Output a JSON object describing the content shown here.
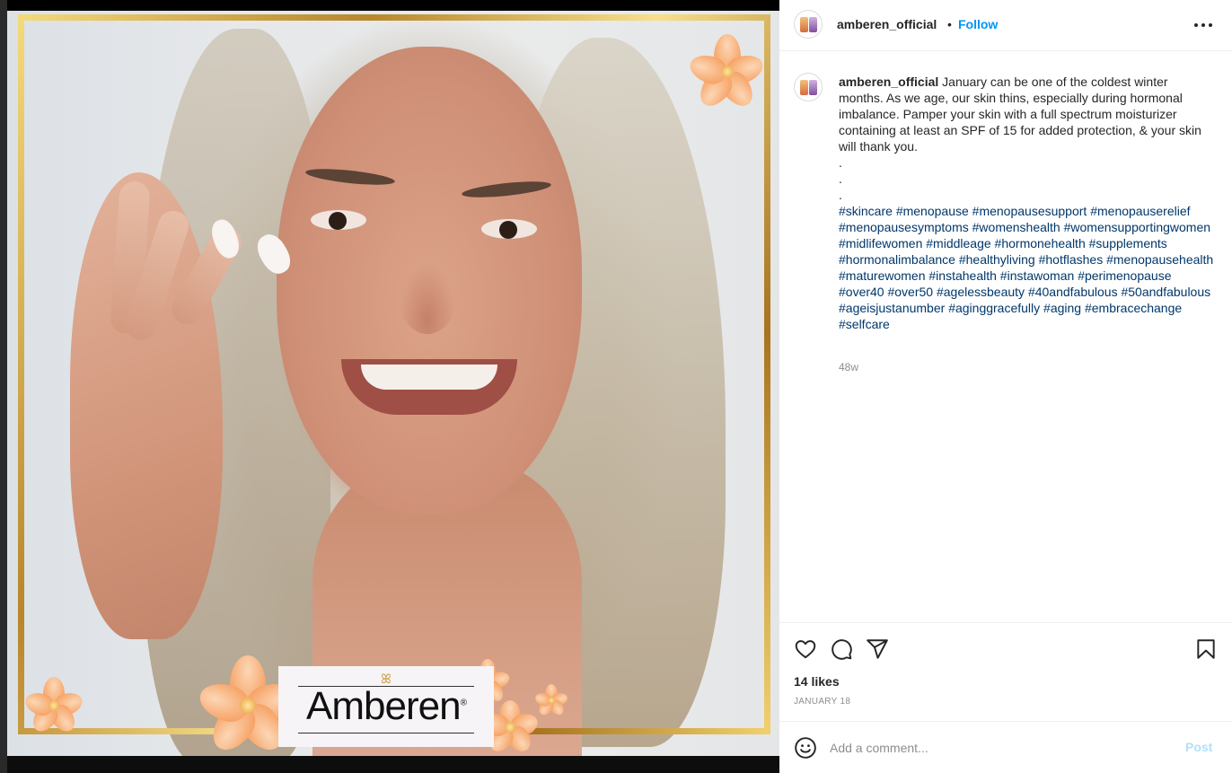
{
  "post": {
    "image_alt": "Smiling woman with long grey-blonde hair applying cream to her face, framed by a gold border with orange flowers",
    "brand_logo_text": "Amberen",
    "brand_logo_mark": "®"
  },
  "header": {
    "username": "amberen_official",
    "separator": "•",
    "follow_label": "Follow",
    "more_icon": "more-horizontal-icon"
  },
  "caption": {
    "username": "amberen_official",
    "text": "January can be one of the coldest winter months. As we age, our skin thins, especially during hormonal imbalance. Pamper your skin with a full spectrum moisturizer containing at least an SPF of 15 for added protection, & your skin will thank you.",
    "dots": [
      ".",
      ".",
      "."
    ],
    "hashtags": [
      "#skincare",
      "#menopause",
      "#menopausesupport",
      "#menopauserelief",
      "#menopausesymptoms",
      "#womenshealth",
      "#womensupportingwomen",
      "#midlifewomen",
      "#middleage",
      "#hormonehealth",
      "#supplements",
      "#hormonalimbalance",
      "#healthyliving",
      "#hotflashes",
      "#menopausehealth",
      "#maturewomen",
      "#instahealth",
      "#instawoman",
      "#perimenopause",
      "#over40",
      "#over50",
      "#agelessbeauty",
      "#40andfabulous",
      "#50andfabulous",
      "#ageisjustanumber",
      "#aginggracefully",
      "#aging",
      "#embracechange",
      "#selfcare"
    ],
    "time_ago": "48w"
  },
  "actions": {
    "like_icon": "heart-icon",
    "comment_icon": "comment-bubble-icon",
    "share_icon": "paper-plane-icon",
    "save_icon": "bookmark-icon",
    "likes_text": "14 likes",
    "date_text": "JANUARY 18"
  },
  "comment": {
    "emoji_icon": "smiley-face-icon",
    "placeholder": "Add a comment...",
    "post_label": "Post"
  },
  "colors": {
    "link_blue": "#0095f6",
    "hashtag_blue": "#00376b",
    "post_disabled": "#b2dffc",
    "frame_gold": "#d4a43a",
    "flower_orange": "#f7a86e"
  }
}
